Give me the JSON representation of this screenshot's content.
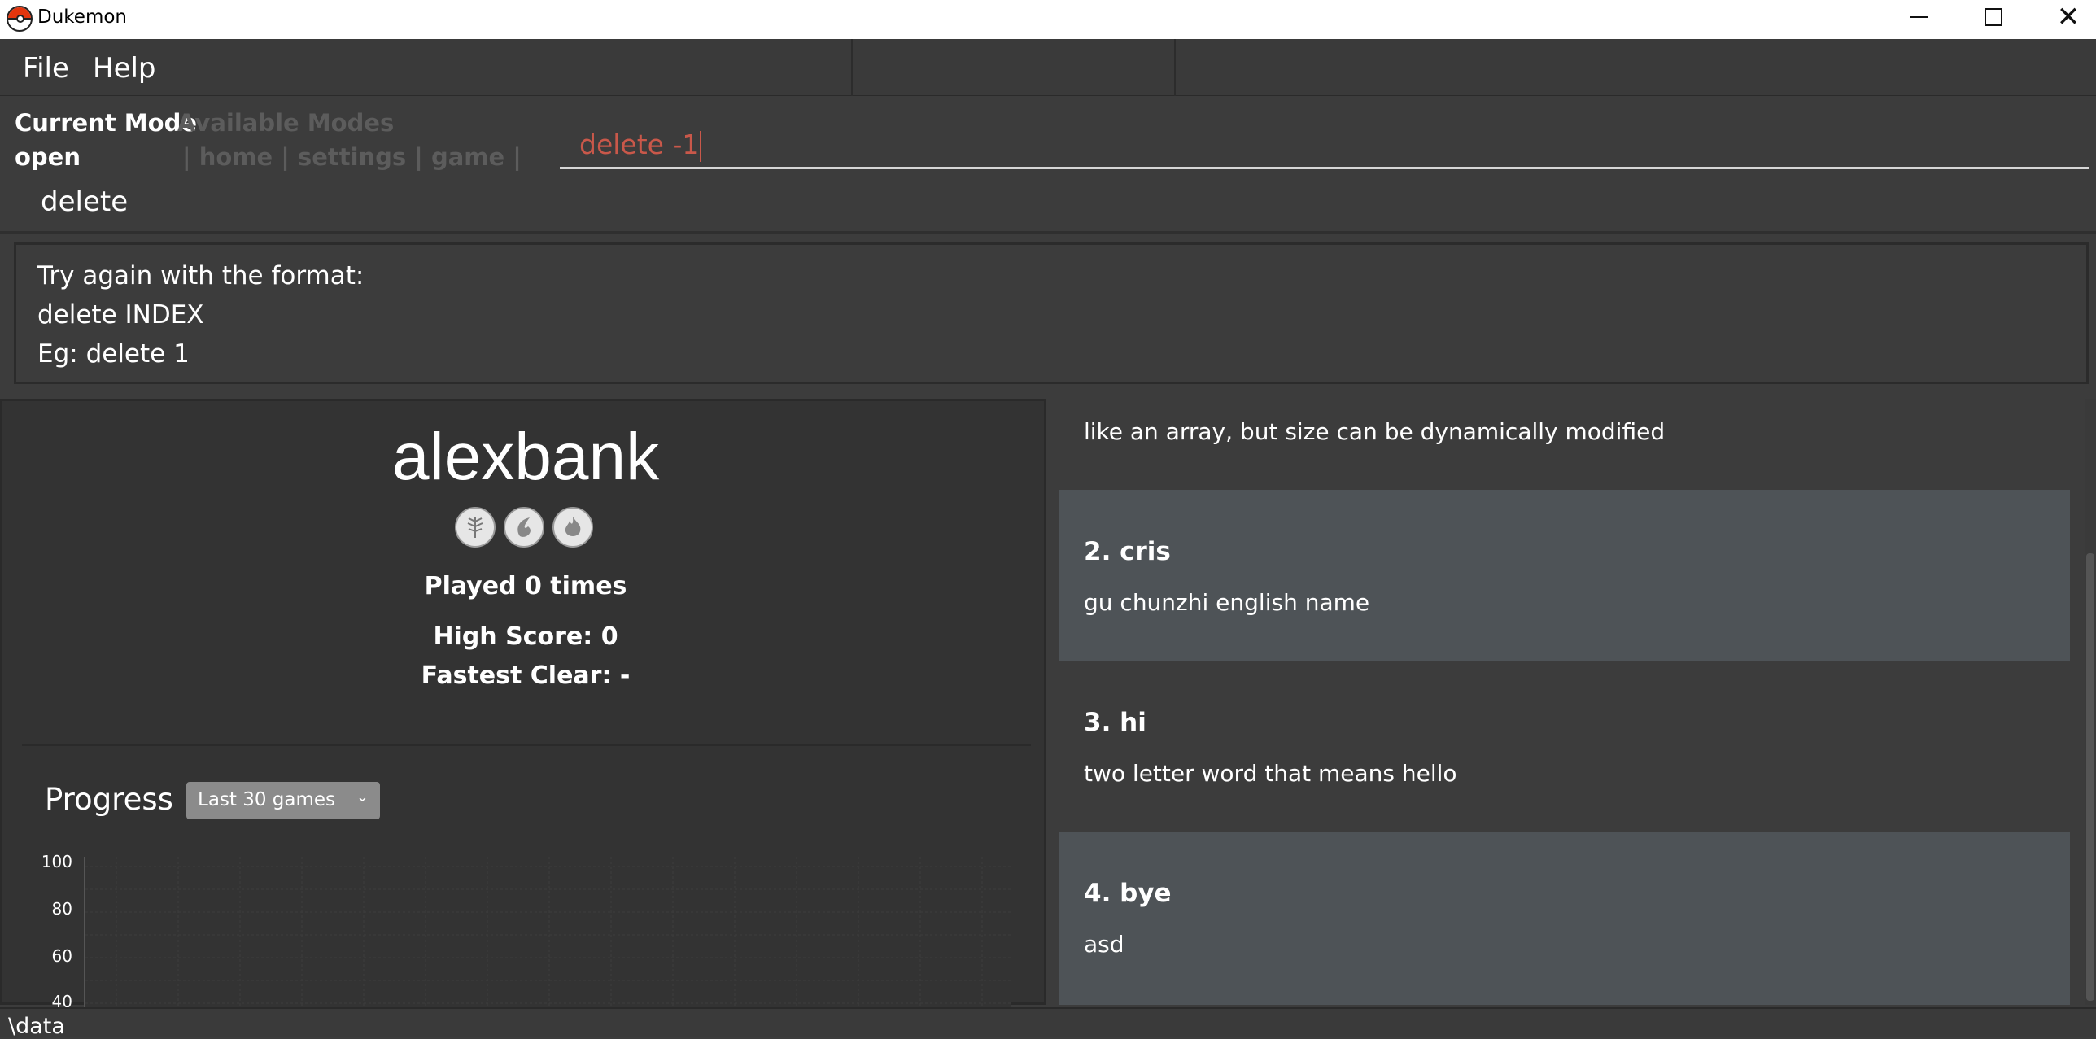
{
  "window": {
    "title": "Dukemon"
  },
  "menu": {
    "file": "File",
    "help": "Help"
  },
  "mode": {
    "current_label": "Current Mode",
    "current_value": "open",
    "available_label": "Available Modes",
    "available_list": "| home | settings | game |",
    "mode_text": "delete"
  },
  "command": {
    "value": "delete -1"
  },
  "result": {
    "line1": "Try again with the format:",
    "line2": "delete INDEX",
    "line3": "Eg: delete 1"
  },
  "profile": {
    "username": "alexbank",
    "badges": [
      "grass-badge-icon",
      "water-badge-icon",
      "fire-badge-icon"
    ],
    "played": "Played 0 times",
    "high_score": "High Score: 0",
    "fastest_clear": "Fastest Clear:  -"
  },
  "progress": {
    "label": "Progress",
    "range_selected": "Last 30 games",
    "y_ticks": [
      "100",
      "80",
      "60",
      "40"
    ]
  },
  "cards": [
    {
      "title": "",
      "desc": "like an array, but size can be dynamically modified"
    },
    {
      "title": "2.  cris",
      "desc": "gu chunzhi english name"
    },
    {
      "title": "3.  hi",
      "desc": "two letter word that means hello"
    },
    {
      "title": "4.  bye",
      "desc": "asd"
    }
  ],
  "status": {
    "path": "\\data"
  },
  "colors": {
    "accent_error": "#c9584a",
    "card_alt": "#4e5357",
    "background": "#3c3c3c"
  }
}
